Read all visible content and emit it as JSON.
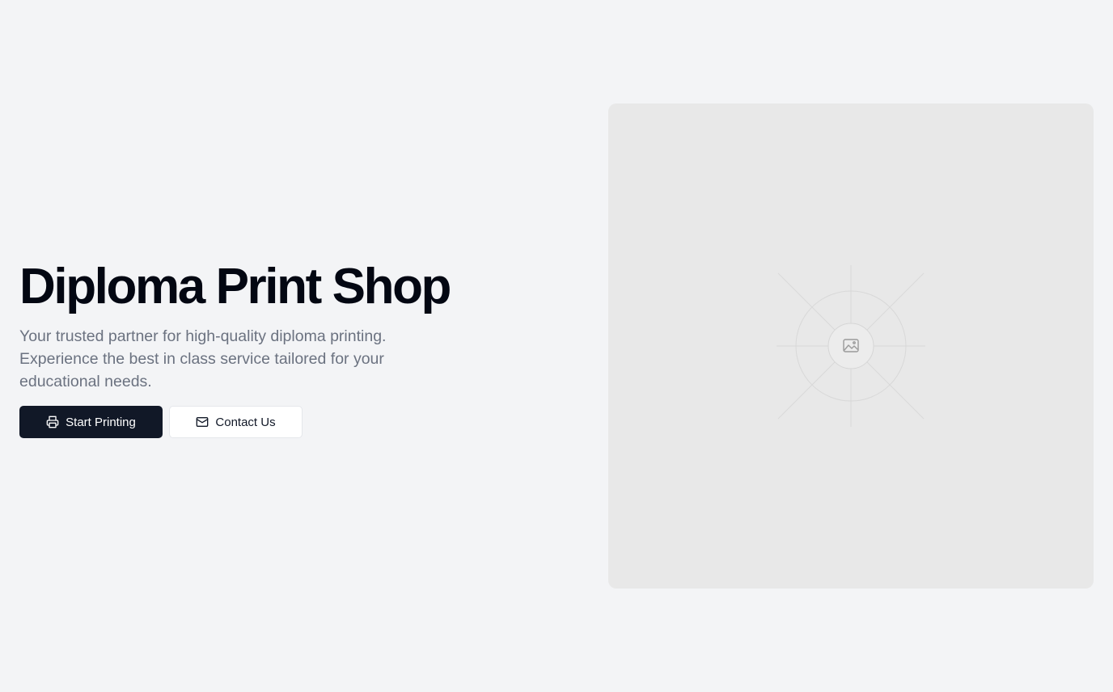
{
  "hero": {
    "title": "Diploma Print Shop",
    "subtitle": "Your trusted partner for high-quality diploma printing. Experience the best in class service tailored for your educational needs."
  },
  "actions": {
    "primary": {
      "label": "Start Printing",
      "icon": "printer-icon"
    },
    "secondary": {
      "label": "Contact Us",
      "icon": "mail-icon"
    }
  },
  "media": {
    "icon": "image-placeholder-icon"
  },
  "colors": {
    "background": "#f3f4f6",
    "primary_button": "#111827",
    "title": "#030712",
    "subtitle": "#6b7280",
    "image_panel": "#e8e8e8"
  }
}
